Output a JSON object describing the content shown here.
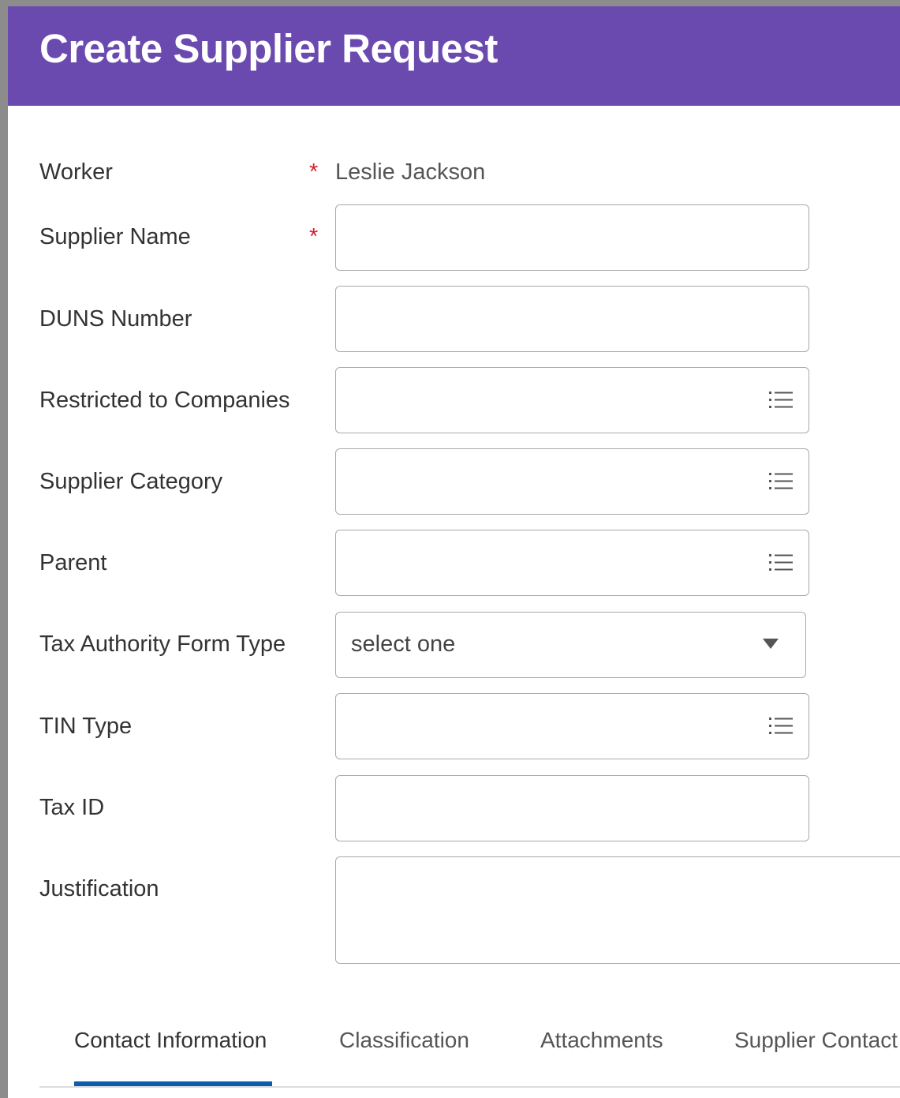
{
  "header": {
    "title": "Create Supplier Request"
  },
  "colors": {
    "header_background": "#6b4ab0",
    "required_marker": "#d31f2f",
    "active_tab_indicator": "#0b5cad"
  },
  "form": {
    "required_marker": "*",
    "worker": {
      "label": "Worker",
      "value": "Leslie Jackson"
    },
    "supplier_name": {
      "label": "Supplier Name",
      "value": ""
    },
    "duns_number": {
      "label": "DUNS Number",
      "value": ""
    },
    "restricted_to_companies": {
      "label": "Restricted to Companies",
      "value": "",
      "icon": "list-icon"
    },
    "supplier_category": {
      "label": "Supplier Category",
      "value": "",
      "icon": "list-icon"
    },
    "parent": {
      "label": "Parent",
      "value": "",
      "icon": "list-icon"
    },
    "tax_authority_form_type": {
      "label": "Tax Authority Form Type",
      "selected": "select one",
      "icon": "caret-down-icon"
    },
    "tin_type": {
      "label": "TIN Type",
      "value": "",
      "icon": "list-icon"
    },
    "tax_id": {
      "label": "Tax ID",
      "value": ""
    },
    "justification": {
      "label": "Justification",
      "value": ""
    }
  },
  "tabs": [
    {
      "label": "Contact Information",
      "active": true
    },
    {
      "label": "Classification",
      "active": false
    },
    {
      "label": "Attachments",
      "active": false
    },
    {
      "label": "Supplier Contact",
      "active": false
    }
  ]
}
